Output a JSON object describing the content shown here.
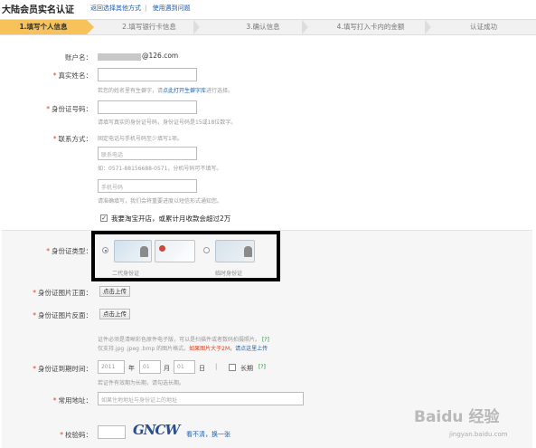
{
  "page": {
    "title": "大陆会员实名认证",
    "link_alt": "返回选择其他方式",
    "link_sep": "|",
    "link_help": "使用遇到问题"
  },
  "steps": [
    {
      "label": "1.填写个人信息",
      "active": true
    },
    {
      "label": "2.填写银行卡信息",
      "active": false
    },
    {
      "label": "3.确认信息",
      "active": false
    },
    {
      "label": "4.填写打入卡内的金额",
      "active": false
    },
    {
      "label": "认证成功",
      "active": false
    }
  ],
  "form": {
    "account": {
      "label": "账户名：",
      "value": "@126.com"
    },
    "realname": {
      "label": "真实姓名：",
      "hint_pre": "若您的姓名里有生僻字，请",
      "hint_link": "点此打开生僻字库",
      "hint_post": "进行选择。"
    },
    "idnum": {
      "label": "身份证号码：",
      "hint": "请填写真实的身份证号码，身份证号码是15或18位数字。"
    },
    "contact": {
      "label": "联系方式：",
      "hint_top": "固定电话与手机号码至少填写1项。",
      "phone_placeholder": "联系电话",
      "phone_hint": "如：0571-88156688-0571，分机号码可不填写。",
      "mobile_placeholder": "手机号码",
      "mobile_hint": "请准确填写，我们会将重要进度以短信形式通知您。"
    },
    "shop_checkbox": "我要淘宝开店，或累计月收款会超过2万",
    "idtype": {
      "label": "身份证类型：",
      "option1": "二代身份证",
      "option2": "临时身份证"
    },
    "idfront": {
      "label": "身份证图片正面：",
      "button": "点击上传"
    },
    "idback": {
      "label": "身份证图片反面：",
      "button": "点击上传"
    },
    "upload_hint": {
      "line1": "证件必须是清晰彩色原件电子版，可以是扫描件或者数码拍摄照片。",
      "line1_tag": "[?]",
      "line2": "仅支持.jpg .jpeg .bmp 的图片格式。",
      "line2_orange": "如果图片大于2M，",
      "line2_link": "请点这里上传"
    },
    "expiry": {
      "label": "身份证到期时间：",
      "year": "2011",
      "year_unit": "年",
      "month": "01",
      "month_unit": "月",
      "day": "01",
      "day_unit": "日",
      "sep": "|",
      "longterm": "长期",
      "longterm_tag": "[?]",
      "hint": "若证件有效期为长期，请勾选长期。"
    },
    "address": {
      "label": "常用地址：",
      "placeholder": "如果住地地址与身份证上的地址"
    },
    "captcha": {
      "label": "校验码：",
      "image_text": "GNCW",
      "refresh": "看不清，换一张"
    }
  },
  "watermark": {
    "main": "Baidu 经验",
    "sub": "jingyan.baidu.com"
  }
}
